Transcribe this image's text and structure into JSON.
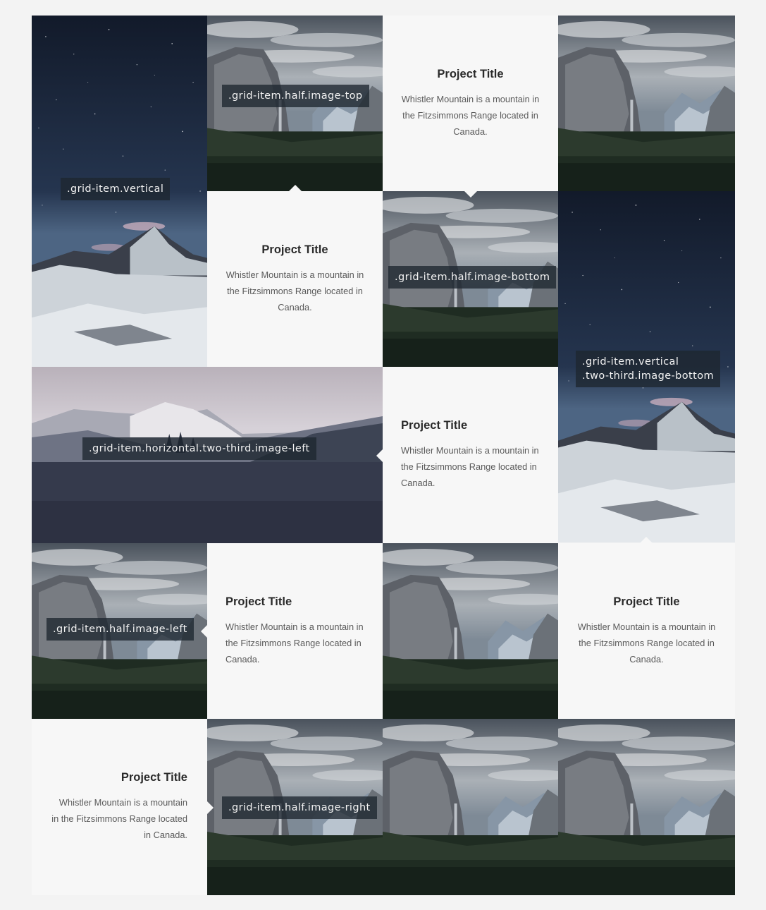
{
  "labels": {
    "vertical": ".grid-item.vertical",
    "half_image_top": ".grid-item.half.image-top",
    "half_image_bottom": ".grid-item.half.image-bottom",
    "vertical_two_third_line1": ".grid-item.vertical",
    "vertical_two_third_line2": ".two-third.image-bottom",
    "horizontal_two_third": ".grid-item.horizontal.two-third.image-left",
    "half_image_left": ".grid-item.half.image-left",
    "half_image_right": ".grid-item.half.image-right"
  },
  "cards": [
    {
      "title": "Project Title",
      "description": "Whistler Mountain is a mountain in the Fitzsimmons Range located in Canada."
    },
    {
      "title": "Project Title",
      "description": "Whistler Mountain is a mountain in the Fitzsimmons Range located in Canada."
    },
    {
      "title": "Project Title",
      "description": "Whistler Mountain is a mountain in the Fitzsimmons Range located in Canada."
    },
    {
      "title": "Project Title",
      "description": "Whistler Mountain is a mountain in the Fitzsimmons Range located in Canada."
    },
    {
      "title": "Project Title",
      "description": "Whistler Mountain is a mountain in the Fitzsimmons Range located in Canada."
    },
    {
      "title": "Project Title",
      "description": "Whistler Mountain is a mountain in the Fitzsimmons Range located in Canada."
    }
  ],
  "colors": {
    "page_background": "#f3f3f3",
    "card_background": "#f7f7f7",
    "label_background": "#1e2630"
  }
}
